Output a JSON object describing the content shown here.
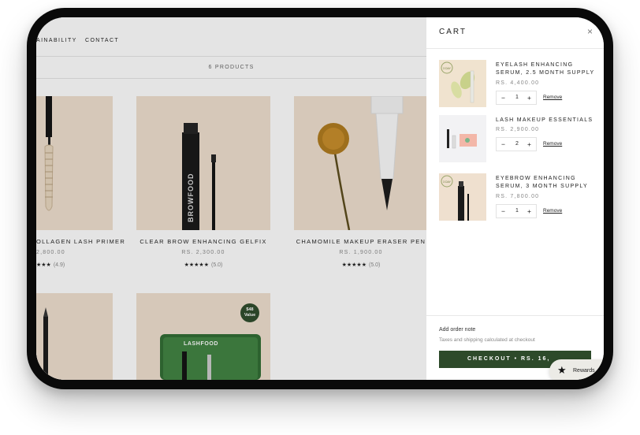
{
  "store": {
    "nav": [
      "AINABILITY",
      "CONTACT"
    ],
    "product_count": "6 PRODUCTS",
    "products": [
      {
        "title": "OLLAGEN LASH PRIMER",
        "price": "2,800.00",
        "stars": "★★★",
        "reviews": "(4.9)"
      },
      {
        "title": "CLEAR BROW ENHANCING GELFIX",
        "price": "RS. 2,300.00",
        "stars": "★★★★★",
        "reviews": "(5.0)"
      },
      {
        "title": "CHAMOMILE MAKEUP ERASER PEN",
        "price": "RS. 1,900.00",
        "stars": "★★★★★",
        "reviews": "(5.0)"
      }
    ],
    "promo_badge": {
      "line1": "$48",
      "line2": "Value"
    },
    "bottle_brand": "BROWFOOD",
    "box_brand": "LASHFOOD"
  },
  "cart": {
    "title": "CART",
    "close_icon": "×",
    "items": [
      {
        "name": "EYELASH ENHANCING SERUM, 2.5 MONTH SUPPLY",
        "price": "RS. 4,400.00",
        "qty": "1",
        "remove": "Remove",
        "badge": "3 DAY"
      },
      {
        "name": "LASH MAKEUP ESSENTIALS",
        "price": "RS. 2,900.00",
        "qty": "2",
        "remove": "Remove"
      },
      {
        "name": "EYEBROW ENHANCING SERUM, 3 MONTH SUPPLY",
        "price": "RS. 7,800.00",
        "qty": "1",
        "remove": "Remove",
        "badge": "3 DAY"
      }
    ],
    "qty_minus": "−",
    "qty_plus": "+",
    "order_note": "Add order note",
    "tax_note": "Taxes and shipping calculated at checkout",
    "checkout_label": "CHECKOUT  •  RS. 16,"
  },
  "rewards": {
    "label": "Rewards",
    "icon": "star-icon"
  },
  "colors": {
    "accent_green": "#2d4a2a",
    "product_bg": "#efe0cf"
  }
}
